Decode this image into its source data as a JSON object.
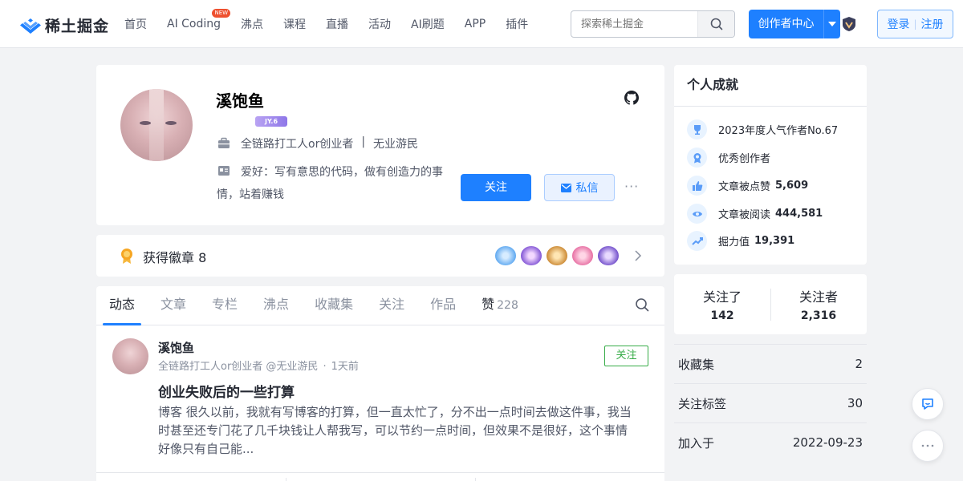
{
  "header": {
    "logo_text": "稀土掘金",
    "nav": [
      {
        "label": "首页"
      },
      {
        "label": "AI Coding",
        "badge": "NEW"
      },
      {
        "label": "沸点"
      },
      {
        "label": "课程"
      },
      {
        "label": "直播"
      },
      {
        "label": "活动"
      },
      {
        "label": "AI刷题"
      },
      {
        "label": "APP"
      },
      {
        "label": "插件"
      }
    ],
    "search_placeholder": "探索稀土掘金",
    "creator_label": "创作者中心",
    "login_label": "登录",
    "register_label": "注册"
  },
  "profile": {
    "name": "溪饱鱼",
    "level": "JY.6",
    "job": "全链路打工人or创业者",
    "company": "无业游民",
    "hobby": "爱好：写有意思的代码，做有创造力的事情，站着赚钱",
    "follow_label": "关注",
    "message_label": "私信",
    "more_label": "···"
  },
  "badges": {
    "label": "获得徽章 8"
  },
  "tabs": [
    {
      "label": "动态",
      "active": true
    },
    {
      "label": "文章"
    },
    {
      "label": "专栏"
    },
    {
      "label": "沸点"
    },
    {
      "label": "收藏集"
    },
    {
      "label": "关注"
    },
    {
      "label": "作品"
    },
    {
      "label": "赞",
      "count": "228"
    }
  ],
  "post": {
    "author": "溪饱鱼",
    "meta_job": "全链路打工人or创业者 @无业游民",
    "meta_time": "1天前",
    "follow_label": "关注",
    "title": "创业失败后的一些打算",
    "body": "博客 很久以前，我就有写博客的打算，但一直太忙了，分不出一点时间去做这件事，我当时甚至还专门花了几千块钱让人帮我写，可以节约一点时间，但效果不是很好，这个事情好像只有自己能..."
  },
  "achievements": {
    "title": "个人成就",
    "items": [
      {
        "label": "2023年度人气作者No.67",
        "value": ""
      },
      {
        "label": "优秀创作者",
        "value": ""
      },
      {
        "label": "文章被点赞",
        "value": "5,609"
      },
      {
        "label": "文章被阅读",
        "value": "444,581"
      },
      {
        "label": "掘力值",
        "value": "19,391"
      }
    ]
  },
  "follows": {
    "following_label": "关注了",
    "following_value": "142",
    "followers_label": "关注者",
    "followers_value": "2,316"
  },
  "stats": [
    {
      "label": "收藏集",
      "value": "2"
    },
    {
      "label": "关注标签",
      "value": "30"
    },
    {
      "label": "加入于",
      "value": "2022-09-23"
    }
  ],
  "colors": {
    "accent": "#1e80ff",
    "follow_green": "#37ac48",
    "background": "#f2f3f5"
  }
}
